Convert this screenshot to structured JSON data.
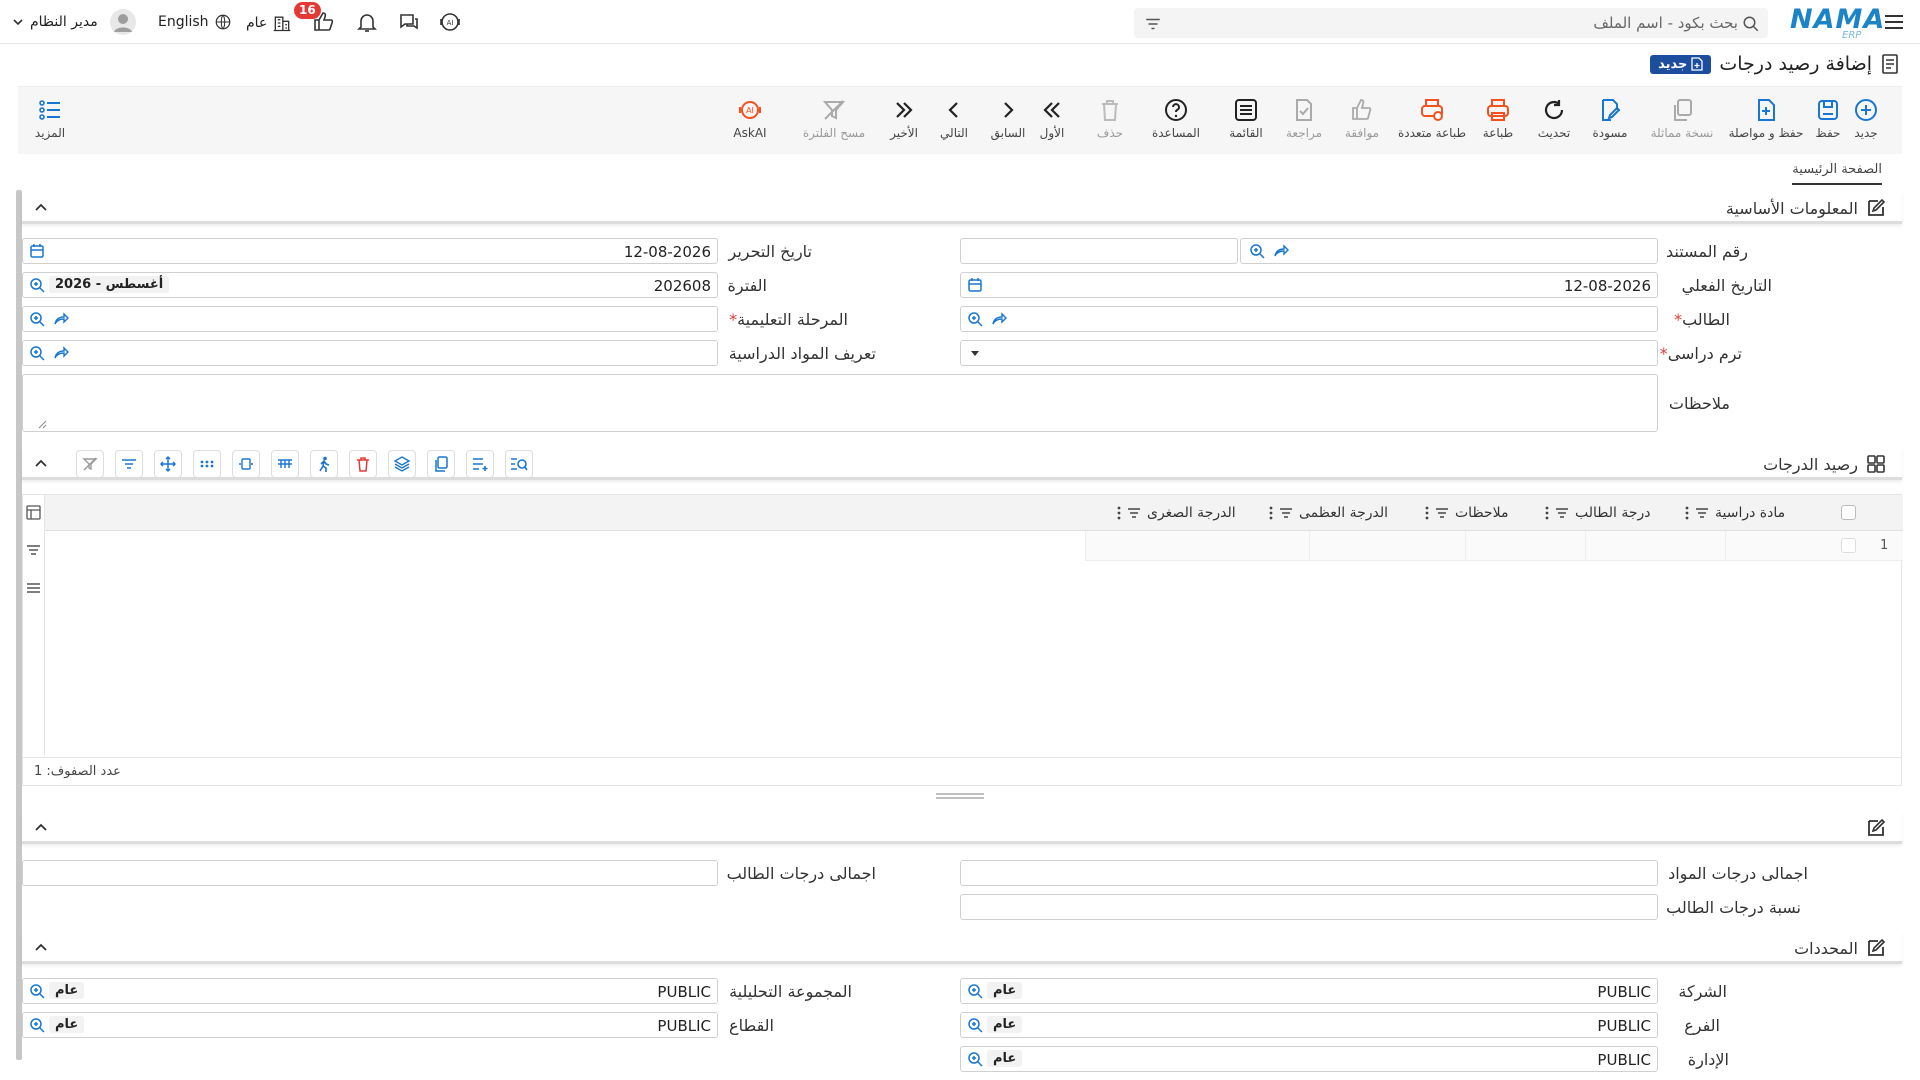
{
  "topbar": {
    "logo": "NAMA",
    "logo_sub": "ERP",
    "search_placeholder": "بحث بكود - اسم الملف",
    "notifications_badge": "16",
    "company_label": "عام",
    "language_label": "English",
    "user_name": "مدير النظام"
  },
  "page": {
    "title": "إضافة رصيد درجات",
    "status_badge": "جديد"
  },
  "toolbar": {
    "new": "جديد",
    "save": "حفظ",
    "save_continue": "حفظ و مواصلة",
    "copy": "نسخة مماثلة",
    "draft": "مسودة",
    "refresh": "تحديث",
    "print": "طباعة",
    "multi_print": "طباعة متعددة",
    "approve": "موافقة",
    "review": "مراجعة",
    "list": "القائمة",
    "help": "المساعدة",
    "delete": "حذف",
    "first": "الأول",
    "prev": "السابق",
    "next": "التالي",
    "last": "الأخير",
    "clear_filter": "مسح الفلترة",
    "askai": "AskAI",
    "more": "المزيد"
  },
  "tabs": {
    "main": "الصفحة الرئيسية"
  },
  "basic_info": {
    "title": "المعلومات الأساسية",
    "doc_number_label": "رقم المستند",
    "edit_date_label": "تاريخ التحرير",
    "edit_date_value": "12-08-2026",
    "actual_date_label": "التاريخ الفعلي",
    "actual_date_value": "12-08-2026",
    "period_label": "الفترة",
    "period_value": "202608",
    "period_chip": "2026 - أغسطس",
    "student_label": "الطالب",
    "stage_label": "المرحلة التعليمية",
    "term_label": "ترم دراسى",
    "subjects_def_label": "تعريف المواد الدراسية",
    "notes_label": "ملاحظات"
  },
  "grades": {
    "title": "رصيد الدرجات",
    "columns": [
      "مادة دراسية",
      "درجة الطالب",
      "ملاحظات",
      "الدرجة العظمى",
      "الدرجة الصغرى"
    ],
    "row_number": "1",
    "row_count": "عدد الصفوف: 1"
  },
  "totals": {
    "subjects_total_label": "اجمالى درجات المواد",
    "student_total_label": "اجمالى درجات الطالب",
    "student_ratio_label": "نسبة درجات الطالب"
  },
  "determinants": {
    "title": "المحددات",
    "company_label": "الشركة",
    "company_value": "PUBLIC",
    "company_chip": "عام",
    "analytic_group_label": "المجموعة التحليلية",
    "analytic_group_value": "PUBLIC",
    "analytic_group_chip": "عام",
    "branch_label": "الفرع",
    "branch_value": "PUBLIC",
    "branch_chip": "عام",
    "sector_label": "القطاع",
    "sector_value": "PUBLIC",
    "sector_chip": "عام",
    "department_label": "الإدارة",
    "department_value": "PUBLIC",
    "department_chip": "عام"
  }
}
